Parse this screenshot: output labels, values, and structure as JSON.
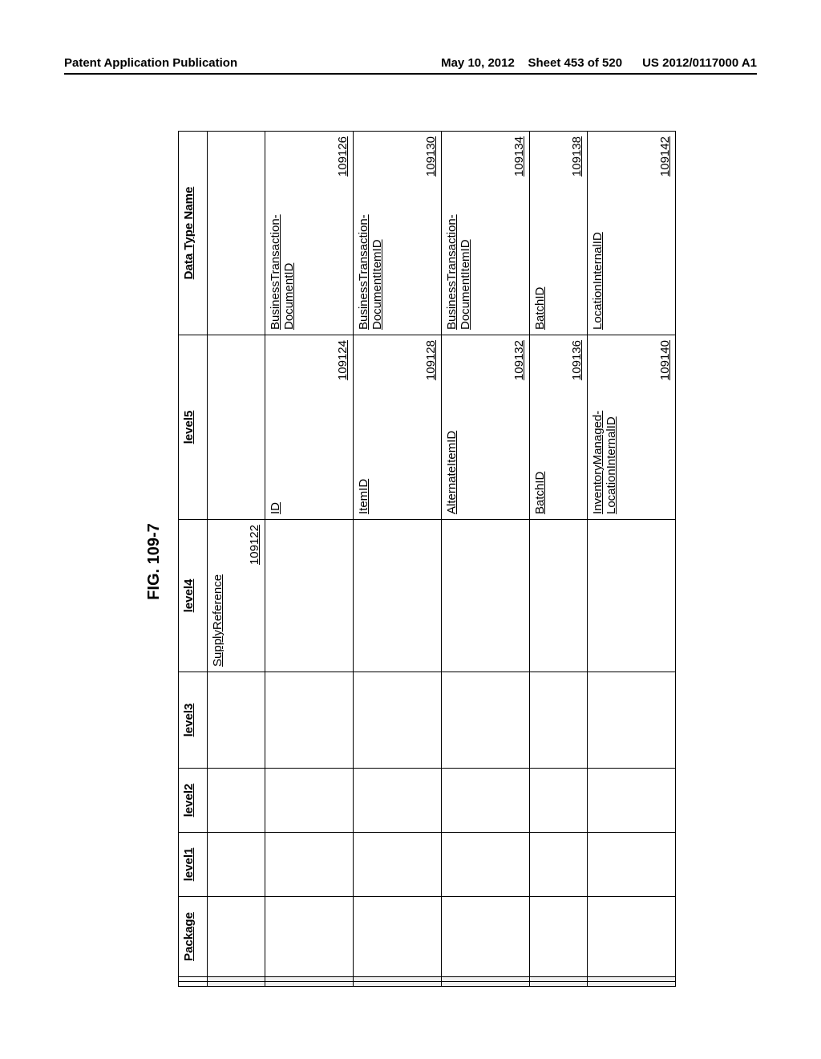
{
  "header": {
    "left": "Patent Application Publication",
    "date": "May 10, 2012",
    "sheet": "Sheet 453 of 520",
    "pubno": "US 2012/0117000 A1"
  },
  "figure": {
    "caption": "FIG. 109-7",
    "columns": {
      "c0": "",
      "c1": "Package",
      "c2": "level1",
      "c3": "level2",
      "c4": "level3",
      "c5": "level4",
      "c6": "level5",
      "c7": "Data Type Name"
    },
    "rows": [
      {
        "level4": "SupplyReference",
        "level4_ref": "109122",
        "level5": "",
        "level5_ref": "",
        "dtn": "",
        "dtn_ref": "",
        "short": true
      },
      {
        "level4": "",
        "level4_ref": "",
        "level5": "ID",
        "level5_ref": "109124",
        "dtn": "BusinessTransaction-\nDocumentID",
        "dtn_ref": "109126"
      },
      {
        "level4": "",
        "level4_ref": "",
        "level5": "ItemID",
        "level5_ref": "109128",
        "dtn": "BusinessTransaction-\nDocumentItemID",
        "dtn_ref": "109130"
      },
      {
        "level4": "",
        "level4_ref": "",
        "level5": "AlternateItemID",
        "level5_ref": "109132",
        "dtn": "BusinessTransaction-\nDocumentItemID",
        "dtn_ref": "109134"
      },
      {
        "level4": "",
        "level4_ref": "",
        "level5": "BatchID",
        "level5_ref": "109136",
        "dtn": "BatchID",
        "dtn_ref": "109138",
        "short": true
      },
      {
        "level4": "",
        "level4_ref": "",
        "level5": "InventoryManaged-\nLocationInternalID",
        "level5_ref": "109140",
        "dtn": "LocationInternalID",
        "dtn_ref": "109142"
      }
    ]
  }
}
